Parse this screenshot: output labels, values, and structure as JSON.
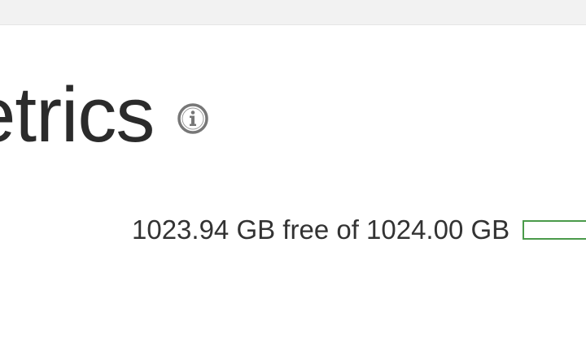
{
  "header": {
    "title": "etrics"
  },
  "info_icon": {
    "name": "info-icon"
  },
  "storage": {
    "label": "1023.94 GB free of 1024.00 GB",
    "used_fraction": 6e-05,
    "bar_color": "#4a9a4a"
  }
}
